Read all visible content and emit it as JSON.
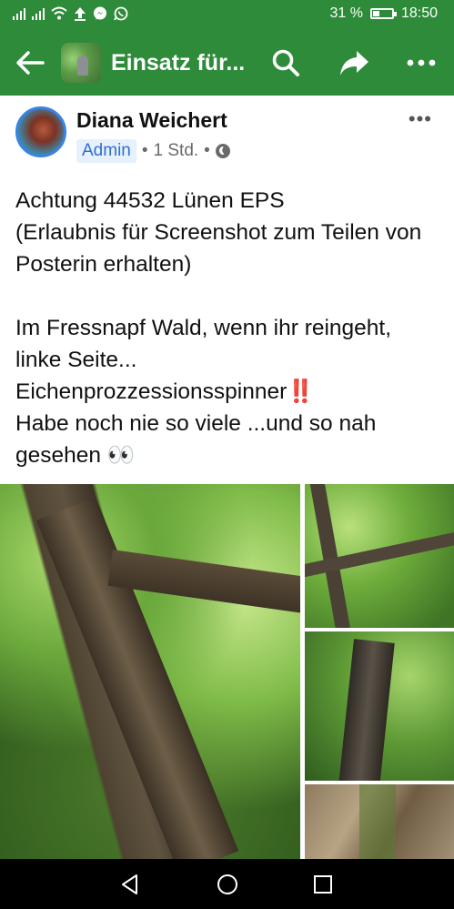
{
  "status_bar": {
    "battery_percent": "31 %",
    "time": "18:50",
    "icons": [
      "signal-icon",
      "signal-icon",
      "wifi-icon",
      "upload-icon",
      "messenger-icon",
      "whatsapp-icon"
    ]
  },
  "app_bar": {
    "title": "Einsatz für...",
    "back_icon": "arrow-left-icon",
    "search_icon": "search-icon",
    "share_icon": "share-icon",
    "more_icon": "more-icon",
    "color": "#2e8b3a"
  },
  "post": {
    "author": "Diana Weichert",
    "role_badge": "Admin",
    "separator": "•",
    "time": "1 Std.",
    "privacy_icon": "globe-icon",
    "more": "•••",
    "text": {
      "line1": "Achtung 44532 Lünen EPS",
      "line2": "(Erlaubnis für Screenshot zum Teilen von Posterin erhalten)",
      "line3": "Im Fressnapf Wald, wenn ihr reingeht, linke Seite...",
      "line4_text": "Eichenprozzessionsspinner",
      "line4_emoji": "‼️",
      "line5": "Habe noch nie so viele ...und so nah gesehen",
      "line5_emoji": "👀"
    },
    "photo_count": 4
  },
  "nav_bar": {
    "icons": [
      "back-triangle-icon",
      "home-circle-icon",
      "recents-square-icon"
    ]
  }
}
